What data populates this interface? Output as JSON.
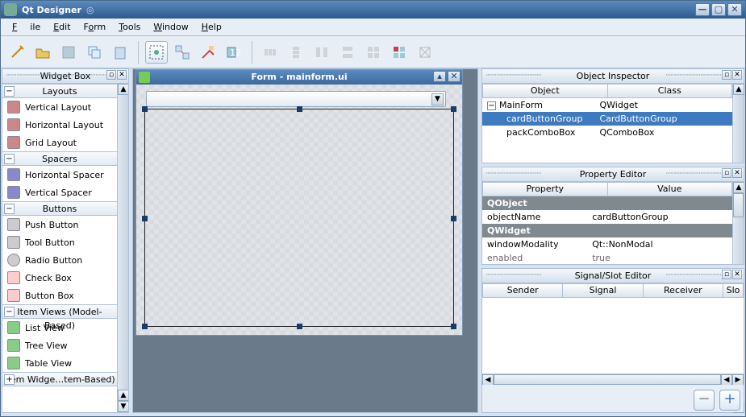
{
  "titlebar": {
    "title": "Qt Designer"
  },
  "menu": {
    "file": "File",
    "edit": "Edit",
    "form": "Form",
    "tools": "Tools",
    "window": "Window",
    "help": "Help"
  },
  "widgetbox": {
    "title": "Widget Box",
    "layouts_header": "Layouts",
    "layouts": [
      "Vertical Layout",
      "Horizontal Layout",
      "Grid Layout"
    ],
    "spacers_header": "Spacers",
    "spacers": [
      "Horizontal Spacer",
      "Vertical Spacer"
    ],
    "buttons_header": "Buttons",
    "buttons": [
      "Push Button",
      "Tool Button",
      "Radio Button",
      "Check Box",
      "Button Box"
    ],
    "itemviews_header": "Item Views (Model-Based)",
    "itemviews": [
      "List View",
      "Tree View",
      "Table View"
    ],
    "itemwidgets_header": "Item Widge…tem-Based)"
  },
  "form": {
    "title": "Form - mainform.ui"
  },
  "inspector": {
    "title": "Object Inspector",
    "col_object": "Object",
    "col_class": "Class",
    "rows": [
      {
        "object": "MainForm",
        "class": "QWidget",
        "sel": false,
        "indent": 0
      },
      {
        "object": "cardButtonGroup",
        "class": "CardButtonGroup",
        "sel": true,
        "indent": 1
      },
      {
        "object": "packComboBox",
        "class": "QComboBox",
        "sel": false,
        "indent": 1
      }
    ]
  },
  "property": {
    "title": "Property Editor",
    "col_prop": "Property",
    "col_val": "Value",
    "sect1": "QObject",
    "r1p": "objectName",
    "r1v": "cardButtonGroup",
    "sect2": "QWidget",
    "r2p": "windowModality",
    "r2v": "Qt::NonModal",
    "r3p": "enabled",
    "r3v": "true"
  },
  "signal": {
    "title": "Signal/Slot Editor",
    "col_sender": "Sender",
    "col_signal": "Signal",
    "col_receiver": "Receiver",
    "col_slot": "Slo"
  }
}
